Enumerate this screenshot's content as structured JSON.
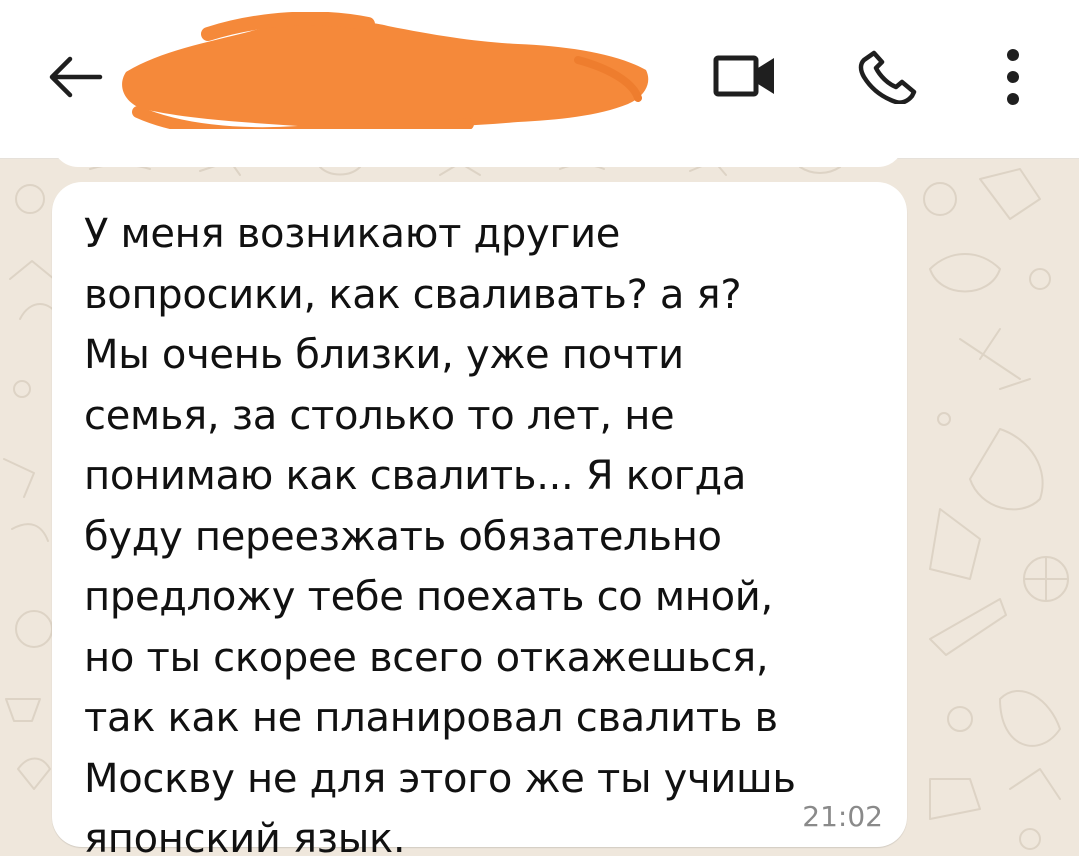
{
  "header": {
    "back_icon": "arrow-left-icon",
    "contact_name": "",
    "contact_redacted": true,
    "redaction_color": "#f5893a",
    "video_icon": "video-camera-icon",
    "call_icon": "phone-icon",
    "more_icon": "more-vertical-icon"
  },
  "chat": {
    "background_color": "#efe7dc",
    "message": {
      "text": "У меня возникают другие\nвопросики, как сваливать?  а я?\nМы очень близки, уже почти\nсемья, за столько то лет, не\nпонимаю как свалить... Я когда\nбуду переезжать обязательно\nпредложу тебе поехать со мной,\nно ты скорее всего откажешься,\nтак как не планировал свалить в\nМоскву не для этого же ты учишь\nяпонский язык.",
      "time": "21:02",
      "bubble_color": "#ffffff"
    }
  }
}
